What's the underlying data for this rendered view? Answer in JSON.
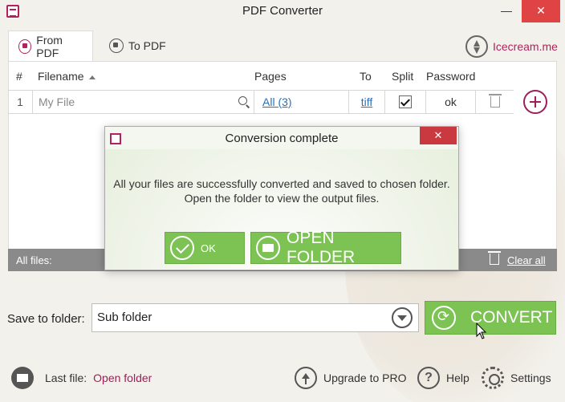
{
  "window": {
    "title": "PDF Converter",
    "minimize": "—",
    "close": "✕"
  },
  "tabs": [
    {
      "label": "From PDF",
      "active": true
    },
    {
      "label": "To PDF",
      "active": false
    }
  ],
  "brand": "Icecream.me",
  "table": {
    "headers": {
      "num": "#",
      "filename": "Filename",
      "pages": "Pages",
      "to": "To",
      "split": "Split",
      "password": "Password"
    },
    "rows": [
      {
        "num": "1",
        "filename_placeholder": "My File",
        "pages": "All (3)",
        "to": "tiff",
        "split": true,
        "password": "ok"
      }
    ],
    "footer": {
      "all_files": "All files:",
      "clear_all": "Clear all"
    }
  },
  "dialog": {
    "title": "Conversion complete",
    "close": "✕",
    "message_line1": "All your files are successfully converted and saved to chosen folder.",
    "message_line2": "Open the folder to view the output files.",
    "ok_label": "OK",
    "open_folder_label": "OPEN FOLDER"
  },
  "save": {
    "label": "Save to folder:",
    "value": "Sub folder",
    "convert_label": "CONVERT"
  },
  "bottom": {
    "last_file_label": "Last file:",
    "last_file_link": "Open folder",
    "upgrade": "Upgrade to PRO",
    "help": "Help",
    "settings": "Settings"
  },
  "colors": {
    "accent": "#9c1f59",
    "green": "#7cc354",
    "close_red": "#e04343",
    "link": "#2a6fb6"
  }
}
